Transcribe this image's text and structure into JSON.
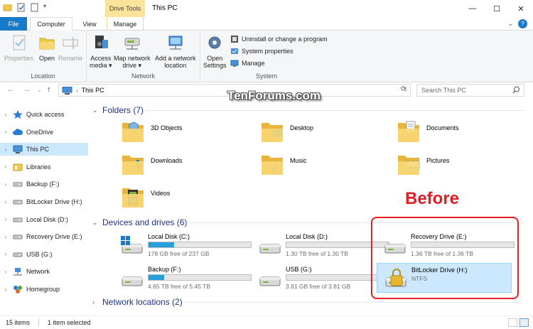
{
  "window": {
    "title": "This PC",
    "context_tab": "Drive Tools",
    "controls": [
      "minimize",
      "maximize",
      "close"
    ]
  },
  "ribbon_tabs": {
    "file": "File",
    "computer": "Computer",
    "view": "View",
    "manage": "Manage"
  },
  "ribbon": {
    "location": {
      "label": "Location",
      "properties": "Properties",
      "open": "Open",
      "rename": "Rename"
    },
    "network": {
      "label": "Network",
      "access_media_1": "Access",
      "access_media_2": "media",
      "map_drive_1": "Map network",
      "map_drive_2": "drive",
      "add_location_1": "Add a network",
      "add_location_2": "location"
    },
    "system": {
      "label": "System",
      "open_settings_1": "Open",
      "open_settings_2": "Settings",
      "uninstall": "Uninstall or change a program",
      "system_properties": "System properties",
      "manage": "Manage"
    }
  },
  "address": {
    "crumb": "This PC",
    "search_placeholder": "Search This PC"
  },
  "watermark": "TenForums.com",
  "nav_pane": {
    "items": [
      {
        "label": "Quick access",
        "icon": "star-icon"
      },
      {
        "label": "OneDrive",
        "icon": "cloud-icon"
      },
      {
        "label": "This PC",
        "icon": "pc-icon",
        "selected": true
      },
      {
        "label": "Libraries",
        "icon": "library-icon"
      },
      {
        "label": "Backup (F:)",
        "icon": "drive-icon"
      },
      {
        "label": "BitLocker Drive (H:)",
        "icon": "drive-icon"
      },
      {
        "label": "Local Disk (D:)",
        "icon": "drive-icon"
      },
      {
        "label": "Recovery Drive (E:)",
        "icon": "drive-icon"
      },
      {
        "label": "USB (G:)",
        "icon": "drive-icon"
      },
      {
        "label": "Network",
        "icon": "network-icon"
      },
      {
        "label": "Homegroup",
        "icon": "homegroup-icon"
      }
    ]
  },
  "folders": {
    "header": "Folders (7)",
    "items": [
      {
        "name": "3D Objects",
        "icon": "3d-objects-folder-icon"
      },
      {
        "name": "Desktop",
        "icon": "desktop-folder-icon"
      },
      {
        "name": "Documents",
        "icon": "documents-folder-icon"
      },
      {
        "name": "Downloads",
        "icon": "downloads-folder-icon"
      },
      {
        "name": "Music",
        "icon": "music-folder-icon"
      },
      {
        "name": "Pictures",
        "icon": "pictures-folder-icon"
      },
      {
        "name": "Videos",
        "icon": "videos-folder-icon"
      }
    ]
  },
  "devices": {
    "header": "Devices and drives (6)",
    "items": [
      {
        "name": "Local Disk (C:)",
        "free": "178 GB free of 237 GB",
        "used_fraction": 0.25,
        "icon": "windows-drive-icon"
      },
      {
        "name": "Local Disk (D:)",
        "free": "1.30 TB free of 1.30 TB",
        "used_fraction": 0.0,
        "icon": "drive-icon"
      },
      {
        "name": "Recovery Drive (E:)",
        "free": "1.36 TB free of 1.36 TB",
        "used_fraction": 0.0,
        "icon": "drive-icon"
      },
      {
        "name": "Backup (F:)",
        "free": "4.65 TB free of 5.45 TB",
        "used_fraction": 0.15,
        "icon": "drive-icon"
      },
      {
        "name": "USB (G:)",
        "free": "3.81 GB free of 3.81 GB",
        "used_fraction": 0.0,
        "icon": "drive-icon"
      },
      {
        "name": "BitLocker Drive (H:)",
        "free": "NTFS",
        "icon": "bitlocker-locked-drive-icon",
        "selected": true
      }
    ]
  },
  "network_locations": {
    "header": "Network locations (2)"
  },
  "annotation": {
    "before": "Before",
    "color": "#e51c23"
  },
  "status": {
    "items_count": "15 items",
    "selected": "1 item selected"
  },
  "colors": {
    "accent": "#1979ca",
    "selection": "#cce8ff",
    "bar_fill": "#26a0da",
    "drive_tools": "#fbe39a",
    "group_header": "#1e3287"
  }
}
